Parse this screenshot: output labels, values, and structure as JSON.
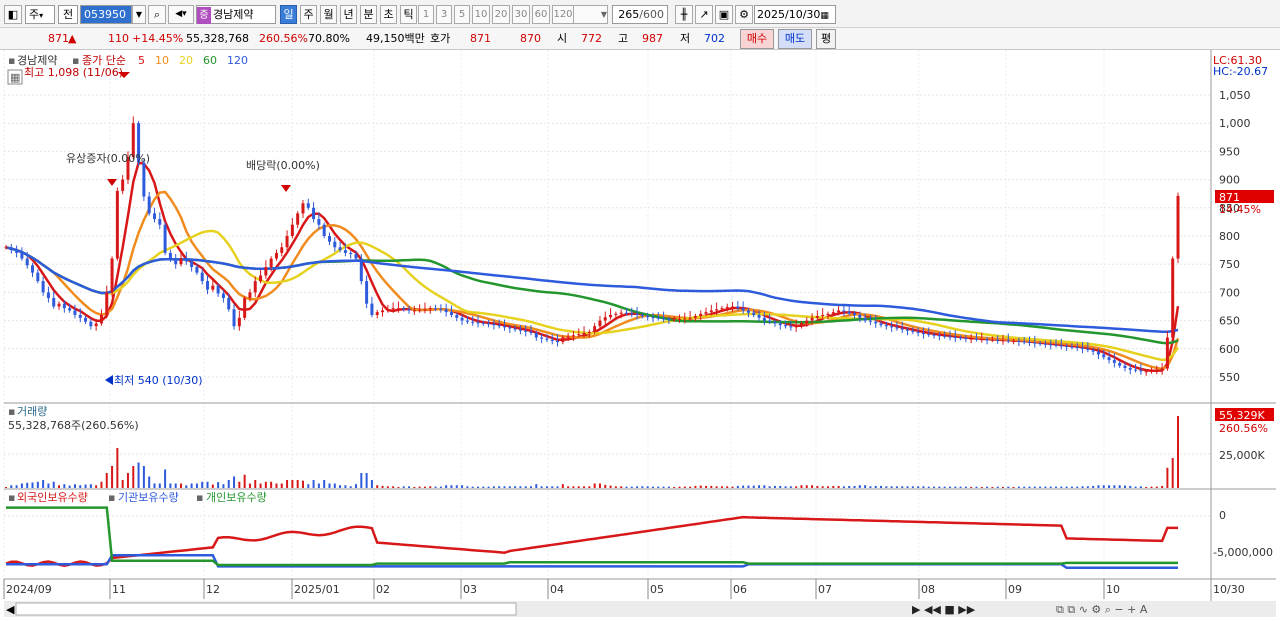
{
  "toolbar": {
    "type_label": "주",
    "period_label": "전",
    "code": "053950",
    "stock_badge": "증",
    "stock_name": "경남제약",
    "periods": [
      "일",
      "주",
      "월",
      "년",
      "분",
      "초",
      "틱"
    ],
    "active_period": "일",
    "numbers": [
      "1",
      "3",
      "5",
      "10",
      "20",
      "30",
      "60",
      "120"
    ],
    "count": "265",
    "total": "/600",
    "date": "2025/10/30"
  },
  "quote": {
    "price": "871",
    "arrow": "▲",
    "change": "110",
    "change_pct": "+14.45%",
    "volume": "55,328,768",
    "volume_ratio": "260.56%",
    "rate": "70.80%",
    "amount": "49,150백만",
    "hoga_label": "호가",
    "ask": "871",
    "bid": "870",
    "open_label": "시",
    "open": "772",
    "high_label": "고",
    "high": "987",
    "low_label": "저",
    "low": "702",
    "buy_label": "매수",
    "sell_label": "매도",
    "eval_label": "평"
  },
  "price_panel": {
    "stock_label": "경남제약",
    "ma_title": "종가 단순",
    "ma_periods": [
      "5",
      "10",
      "20",
      "60",
      "120"
    ],
    "ma_colors": [
      "#d81818",
      "#f08c1e",
      "#e6d21e",
      "#24962e",
      "#2e5adc"
    ],
    "max_label": "최고 1,098 (11/06)",
    "min_label": "최저 540 (10/30)",
    "event1": "유상증자(0.00%)",
    "event2": "배당락(0.00%)",
    "lc": "LC:61.30",
    "hc": "HC:-20.67",
    "price_tag": "871",
    "pct_tag": "14.45%",
    "yticks": [
      "1,050",
      "1,000",
      "950",
      "900",
      "850",
      "800",
      "750",
      "700",
      "650",
      "600",
      "550"
    ]
  },
  "volume_panel": {
    "title": "거래량",
    "value_label": "55,328,768주(260.56%)",
    "tag1": "55,329K",
    "tag2": "260.56%",
    "ytick": "25,000K"
  },
  "holdings_panel": {
    "series": [
      "외국인보유수량",
      "기관보유수량",
      "개인보유수량"
    ],
    "colors": [
      "#d81818",
      "#2e5adc",
      "#24962e"
    ],
    "yticks": [
      "0",
      "-5,000,000"
    ]
  },
  "xaxis": {
    "labels": [
      "2024/09",
      "11",
      "12",
      "2025/01",
      "02",
      "03",
      "04",
      "05",
      "06",
      "07",
      "08",
      "09",
      "10"
    ],
    "last": "10/30"
  },
  "chart_data": {
    "type": "candlestick",
    "ylim": [
      520,
      1090
    ],
    "closes": [
      780,
      775,
      770,
      760,
      748,
      735,
      720,
      700,
      690,
      675,
      680,
      672,
      668,
      660,
      655,
      648,
      640,
      645,
      660,
      700,
      760,
      880,
      900,
      940,
      1000,
      930,
      870,
      840,
      830,
      820,
      770,
      760,
      750,
      760,
      755,
      745,
      735,
      720,
      705,
      712,
      698,
      690,
      670,
      640,
      655,
      690,
      700,
      720,
      730,
      745,
      760,
      770,
      780,
      800,
      820,
      840,
      858,
      850,
      830,
      820,
      800,
      790,
      780,
      775,
      770,
      768,
      760,
      720,
      680,
      660,
      665,
      668,
      670,
      672,
      672,
      670,
      668,
      668,
      669,
      670,
      672,
      671,
      670,
      665,
      660,
      655,
      650,
      648,
      647,
      646,
      645,
      644,
      642,
      640,
      638,
      636,
      634,
      632,
      630,
      628,
      620,
      618,
      616,
      614,
      612,
      620,
      622,
      624,
      626,
      628,
      630,
      640,
      650,
      656,
      660,
      662,
      664,
      663,
      662,
      660,
      658,
      656,
      655,
      654,
      653,
      652,
      652,
      653,
      654,
      655,
      658,
      662,
      665,
      668,
      670,
      672,
      674,
      675,
      672,
      668,
      664,
      660,
      655,
      650,
      648,
      645,
      642,
      640,
      638,
      640,
      645,
      650,
      655,
      658,
      660,
      662,
      665,
      668,
      666,
      663,
      660,
      655,
      650,
      648,
      645,
      642,
      640,
      638,
      636,
      634,
      632,
      630,
      628,
      626,
      625,
      624,
      623,
      622,
      621,
      620,
      619,
      618,
      618,
      617,
      617,
      616,
      616,
      615,
      615,
      614,
      614,
      613,
      612,
      611,
      610,
      609,
      608,
      607,
      606,
      605,
      604,
      603,
      602,
      600,
      598,
      595,
      590,
      585,
      580,
      575,
      570,
      566,
      563,
      562,
      560,
      560,
      561,
      562,
      565,
      620,
      760,
      871
    ]
  }
}
